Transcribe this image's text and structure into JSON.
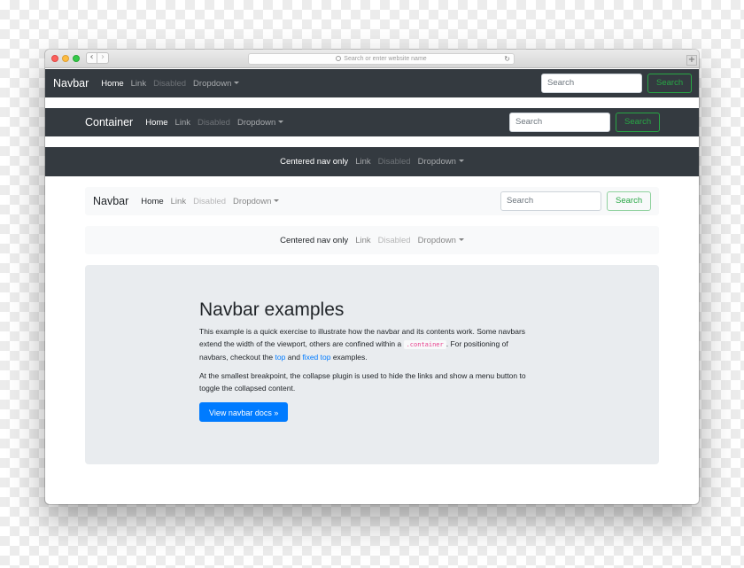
{
  "browser": {
    "back_glyph": "‹",
    "forward_glyph": "›",
    "url_placeholder": "Search or enter website name",
    "reload_glyph": "↻",
    "new_tab_glyph": "+"
  },
  "navbar1": {
    "brand": "Navbar",
    "home": "Home",
    "link": "Link",
    "disabled": "Disabled",
    "dropdown": "Dropdown",
    "search_placeholder": "Search",
    "search_button": "Search"
  },
  "navbar2": {
    "brand": "Container",
    "home": "Home",
    "link": "Link",
    "disabled": "Disabled",
    "dropdown": "Dropdown",
    "search_placeholder": "Search",
    "search_button": "Search"
  },
  "navbar3": {
    "centered": "Centered nav only",
    "link": "Link",
    "disabled": "Disabled",
    "dropdown": "Dropdown"
  },
  "navbar4": {
    "brand": "Navbar",
    "home": "Home",
    "link": "Link",
    "disabled": "Disabled",
    "dropdown": "Dropdown",
    "search_placeholder": "Search",
    "search_button": "Search"
  },
  "navbar5": {
    "centered": "Centered nav only",
    "link": "Link",
    "disabled": "Disabled",
    "dropdown": "Dropdown"
  },
  "jumbotron": {
    "title": "Navbar examples",
    "p1_part1": "This example is a quick exercise to illustrate how the navbar and its contents work. Some navbars extend the width of the viewport, others are confined within a",
    "p1_code": ".container",
    "p1_part2": ". For positioning of navbars, checkout the",
    "p1_link1": "top",
    "p1_and": "and",
    "p1_link2": "fixed top",
    "p1_part3": "examples.",
    "p2": "At the smallest breakpoint, the collapse plugin is used to hide the links and show a menu button to toggle the collapsed content.",
    "button": "View navbar docs »"
  },
  "colors": {
    "dark_navbar": "#343a40",
    "light_navbar": "#f8f9fa",
    "success": "#28a745",
    "primary": "#007bff",
    "jumbotron_bg": "#e9ecef"
  }
}
